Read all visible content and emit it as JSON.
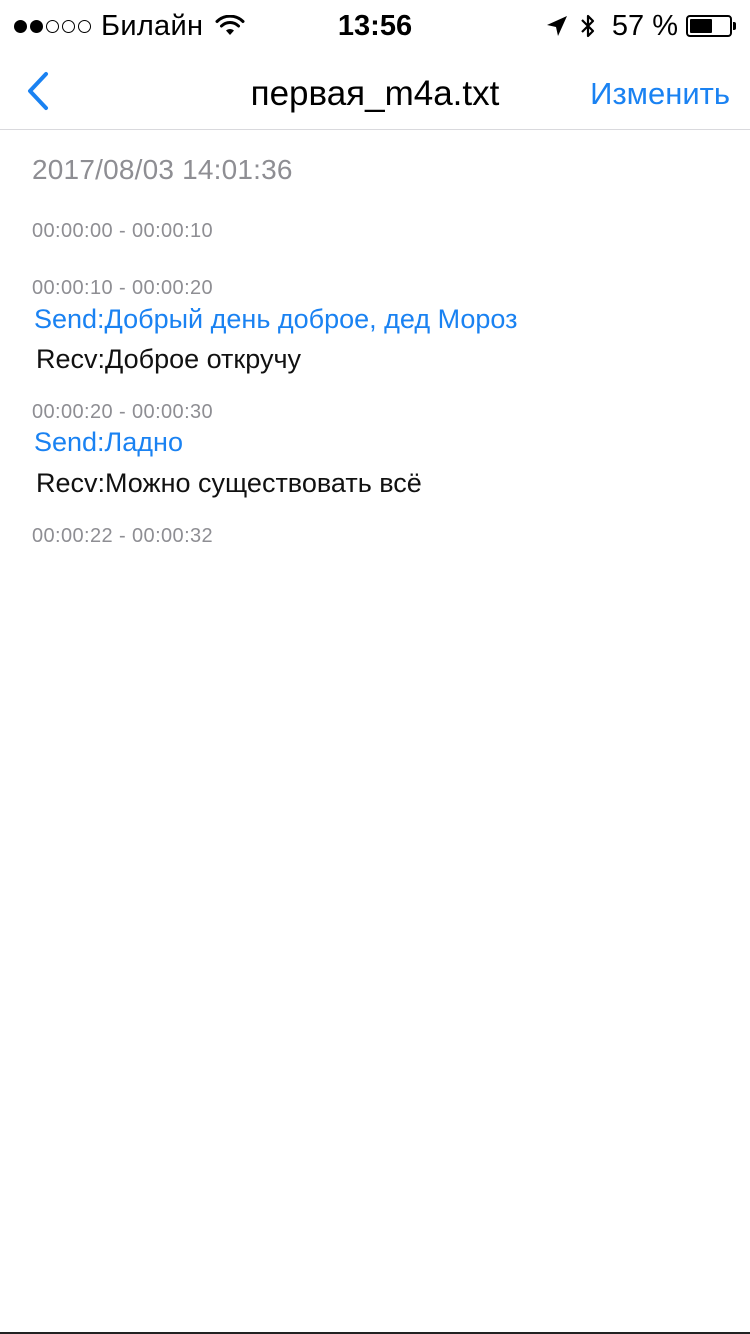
{
  "status_bar": {
    "carrier": "Билайн",
    "time": "13:56",
    "battery_text": "57 %",
    "battery_level": 0.57,
    "signal_bars_filled": 2,
    "signal_bars_total": 5
  },
  "nav": {
    "title": "первая_m4a.txt",
    "edit_label": "Изменить"
  },
  "transcript": {
    "date": "2017/08/03 14:01:36",
    "segments": [
      {
        "time": "00:00:00 - 00:00:10"
      },
      {
        "time": "00:00:10 - 00:00:20",
        "send": "Send:Добрый день доброе, дед Мороз",
        "recv": "Recv:Доброе откручу"
      },
      {
        "time": "00:00:20 - 00:00:30",
        "send": "Send:Ладно",
        "recv": "Recv:Можно существовать всё"
      },
      {
        "time": "00:00:22 - 00:00:32"
      }
    ]
  },
  "colors": {
    "accent": "#1a82f2",
    "muted": "#8e8e93"
  }
}
